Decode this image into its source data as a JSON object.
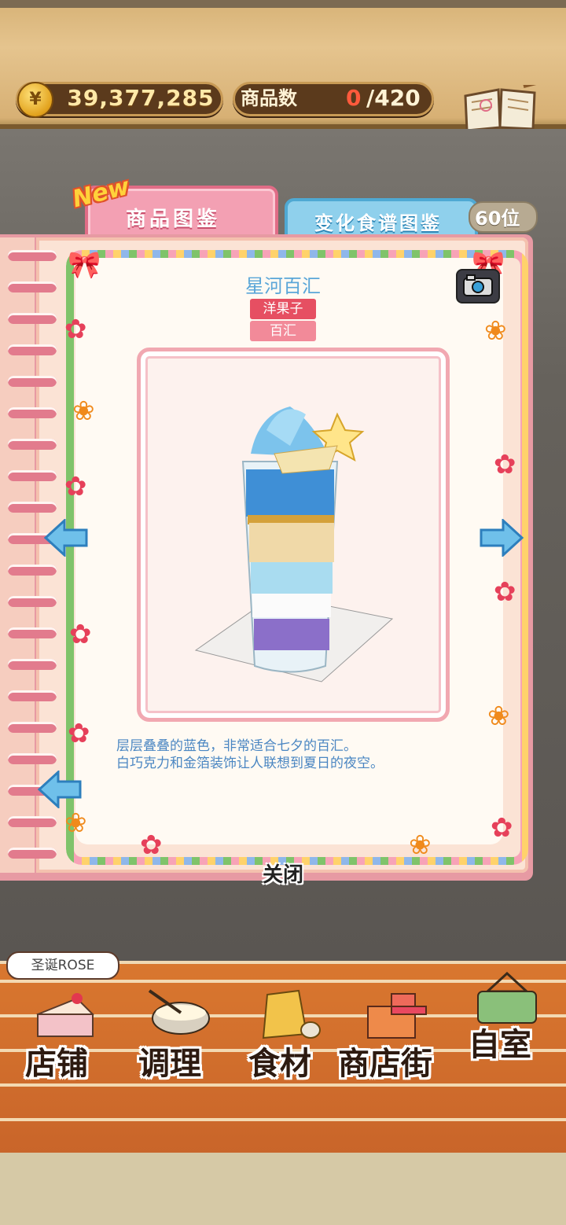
{
  "header": {
    "currency_symbol": "¥",
    "money": "39,377,285",
    "goods_label": "商品数",
    "goods_count": "0",
    "goods_total": "/420",
    "recipe_button_label": "食谱"
  },
  "tabs": {
    "new_badge": "New",
    "goods_catalog": "商品图鉴",
    "recipe_catalog": "变化食谱图鉴",
    "rank": "60位"
  },
  "item": {
    "title": "星河百汇",
    "tags": [
      "洋果子",
      "百汇"
    ],
    "description_line1": "层层叠叠的蓝色，非常适合七夕的百汇。",
    "description_line2": "白巧克力和金箔装饰让人联想到夏日的夜空。"
  },
  "close_label": "关闭",
  "store_name": "圣诞ROSE",
  "nav": [
    {
      "label": "店铺",
      "icon": "cake-icon"
    },
    {
      "label": "调理",
      "icon": "mixing-bowl-icon"
    },
    {
      "label": "食材",
      "icon": "ingredient-bag-icon"
    },
    {
      "label": "商店街",
      "icon": "shop-street-icon"
    },
    {
      "label": "自室",
      "icon": "staff-only-sign-icon"
    }
  ],
  "colors": {
    "wood": "#d9b57a",
    "tab_pink": "#f3a0b3",
    "tab_blue": "#8fd0ec",
    "title_blue": "#5aa6d8",
    "brick": "#c9652a"
  }
}
